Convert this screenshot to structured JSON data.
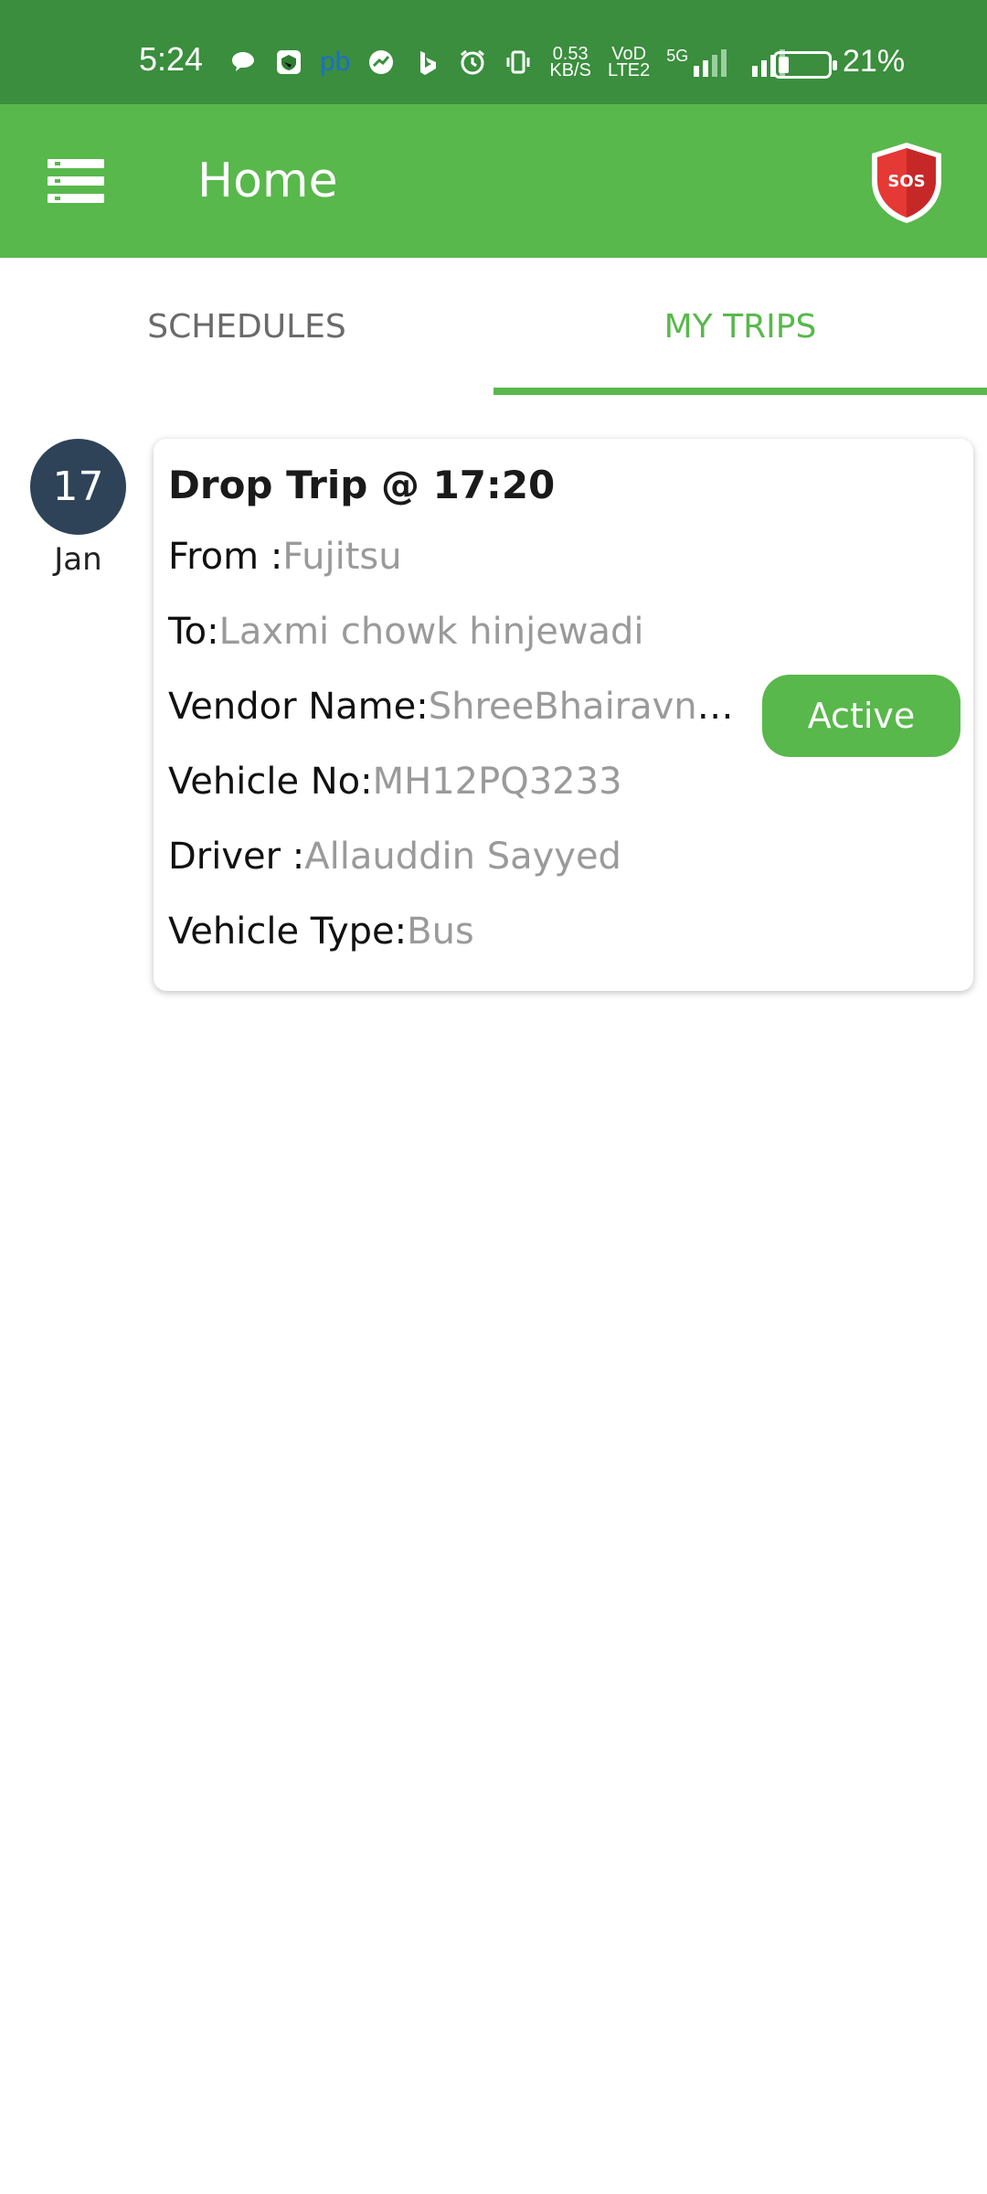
{
  "status_bar": {
    "time": "5:24",
    "speed_value": "0.53",
    "speed_unit": "KB/S",
    "pb_label": "pb",
    "volte_top": "VoD",
    "volte_bottom": "LTE2",
    "network_label": "5G",
    "battery_percent": "21%",
    "battery_level": 0.21,
    "icons": [
      "message-icon",
      "shield-app-icon",
      "pb-app-icon",
      "pie-chart-icon",
      "bing-icon",
      "alarm-icon",
      "vibrate-icon",
      "data-speed-icon",
      "volte-icon",
      "signal-5g-icon",
      "signal-icon",
      "battery-icon"
    ]
  },
  "app_bar": {
    "title": "Home",
    "menu_icon": "menu-icon",
    "sos_label": "SOS",
    "colors": {
      "primary": "#58b84b",
      "status": "#3a8e3d",
      "sos_red": "#e53935"
    }
  },
  "tabs": [
    {
      "label": "SCHEDULES",
      "selected": false
    },
    {
      "label": "MY TRIPS",
      "selected": true
    }
  ],
  "trip": {
    "day": "17",
    "month": "Jan",
    "title": "Drop Trip @ 17:20",
    "from_label": "From :",
    "from_value": "Fujitsu",
    "to_label": "To:",
    "to_value": "Laxmi chowk hinjewadi",
    "vendor_label": "Vendor Name:",
    "vendor_value": "ShreeBhairavnath Travels",
    "vehicle_label": "Vehicle No:",
    "vehicle_value": "MH12PQ3233",
    "driver_label": "Driver :",
    "driver_value": "Allauddin Sayyed",
    "type_label": "Vehicle Type:",
    "type_value": "Bus",
    "status": "Active",
    "badge_color": "#2e4358"
  }
}
